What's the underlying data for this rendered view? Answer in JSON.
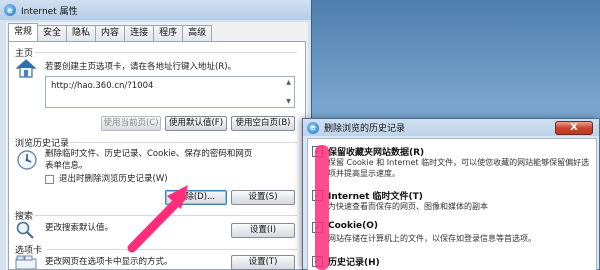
{
  "main_window": {
    "title": "Internet 属性",
    "tabs": [
      {
        "label": "常规",
        "active": true
      },
      {
        "label": "安全",
        "active": false
      },
      {
        "label": "隐私",
        "active": false
      },
      {
        "label": "内容",
        "active": false
      },
      {
        "label": "连接",
        "active": false
      },
      {
        "label": "程序",
        "active": false
      },
      {
        "label": "高级",
        "active": false
      }
    ],
    "homepage": {
      "group_title": "主页",
      "description": "若要创建主页选项卡，请在各地址行键入地址(R)。",
      "url": "http://hao.360.cn/?1004",
      "buttons": {
        "use_current": "使用当前页(C)",
        "use_default": "使用默认值(F)",
        "use_blank": "使用空白页(B)"
      }
    },
    "history": {
      "group_title": "浏览历史记录",
      "description_line1": "删除临时文件、历史记录、Cookie、保存的密码和网页",
      "description_line2": "表单信息。",
      "exit_delete_label": "退出时删除浏览历史记录(W)",
      "delete_button": "删除(D)...",
      "settings_button": "设置(S)"
    },
    "search": {
      "group_title": "搜索",
      "description": "更改搜索默认值。",
      "settings_button": "设置(I)"
    },
    "tabs_section": {
      "group_title": "选项卡",
      "description": "更改网页在选项卡中显示的方式。",
      "settings_button": "设置(T)"
    }
  },
  "delete_dialog": {
    "title": "删除浏览的历史记录",
    "close_symbol": "X",
    "items": [
      {
        "title": "保留收藏夹网站数据(R)",
        "checked": true,
        "desc": "保留 Cookie 和 Internet 临时文件，可以使您收藏的网站能够保留偏好选项并提高显示速度。"
      },
      {
        "title": "Internet 临时文件(T)",
        "checked": true,
        "desc": "为快速查看而保存的网页、图像和媒体的副本"
      },
      {
        "title": "Cookie(O)",
        "checked": true,
        "desc": "网站存储在计算机上的文件，以保存如登录信息等首选项。"
      },
      {
        "title": "历史记录(H)",
        "checked": true,
        "desc": ""
      }
    ]
  },
  "colors": {
    "annotation": "#ff2d7a",
    "close_button": "#c7452f"
  }
}
